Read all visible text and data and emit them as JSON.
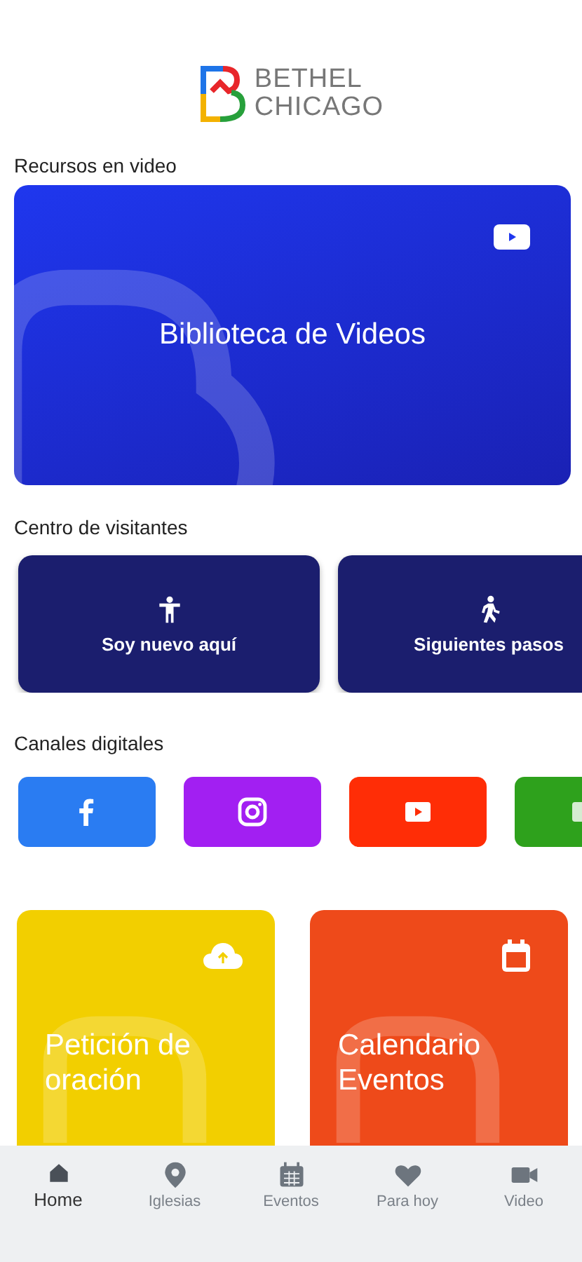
{
  "logo": {
    "line_1": "BETHEL",
    "line_2": "CHICAGO"
  },
  "video_section": {
    "title": "Recursos en video",
    "banner": "Biblioteca de Videos"
  },
  "visitor_section": {
    "title": "Centro de visitantes",
    "cards": [
      {
        "label": "Soy nuevo aquí"
      },
      {
        "label": "Siguientes pasos"
      }
    ]
  },
  "channels_section": {
    "title": "Canales digitales",
    "channels": [
      {
        "color": "#2a7cf2"
      },
      {
        "color": "#a21ff2"
      },
      {
        "color": "#ff2d06"
      },
      {
        "color": "#2ea11c"
      }
    ]
  },
  "tiles": [
    {
      "label": "Petición de oración",
      "color": "#f2cf00"
    },
    {
      "label": "Calendario Eventos",
      "color": "#ee4a1a"
    }
  ],
  "tab_bar": [
    {
      "label": "Home",
      "selected": true
    },
    {
      "label": "Iglesias",
      "selected": false
    },
    {
      "label": "Eventos",
      "selected": false
    },
    {
      "label": "Para hoy",
      "selected": false
    },
    {
      "label": "Video",
      "selected": false
    }
  ]
}
